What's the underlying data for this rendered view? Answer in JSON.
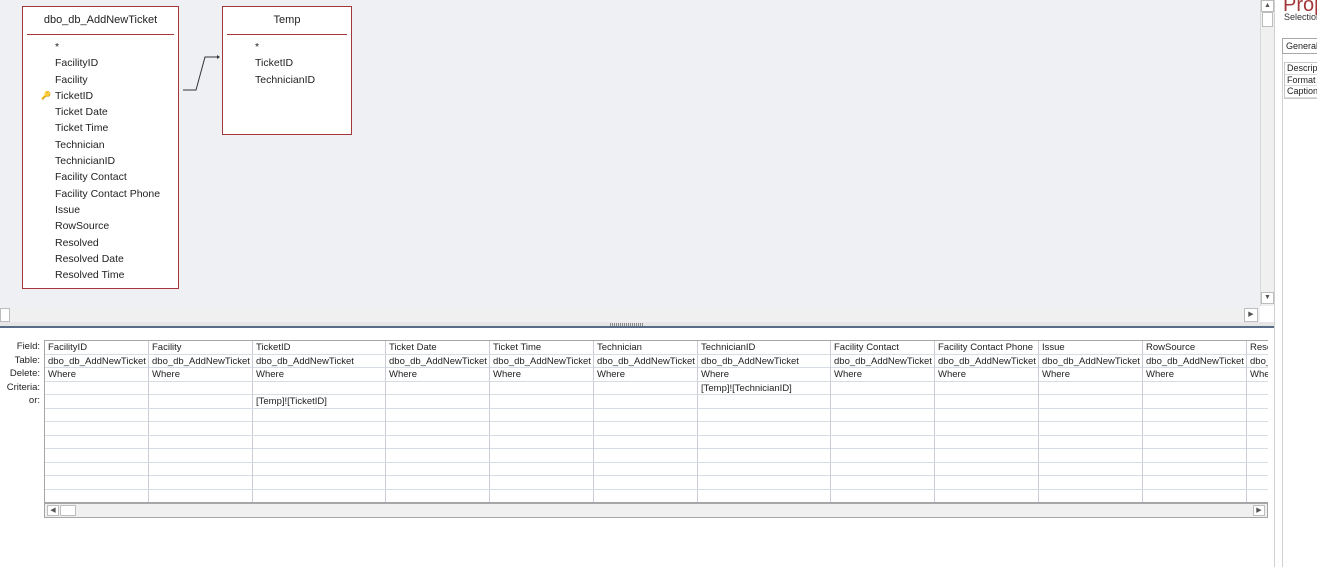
{
  "diagram": {
    "tables": [
      {
        "name": "dbo_db_AddNewTicket",
        "fields": [
          "*",
          "FacilityID",
          "Facility",
          "TicketID",
          "Ticket Date",
          "Ticket Time",
          "Technician",
          "TechnicianID",
          "Facility Contact",
          "Facility Contact Phone",
          "Issue",
          "RowSource",
          "Resolved",
          "Resolved Date",
          "Resolved Time"
        ],
        "primary_key": "TicketID"
      },
      {
        "name": "Temp",
        "fields": [
          "*",
          "TicketID",
          "TechnicianID"
        ]
      }
    ]
  },
  "qbe": {
    "row_labels": [
      "Field:",
      "Table:",
      "Delete:",
      "Criteria:",
      "or:"
    ],
    "columns": [
      {
        "field": "FacilityID",
        "table": "dbo_db_AddNewTicket",
        "delete": "Where",
        "criteria": "",
        "or": ""
      },
      {
        "field": "Facility",
        "table": "dbo_db_AddNewTicket",
        "delete": "Where",
        "criteria": "",
        "or": ""
      },
      {
        "field": "TicketID",
        "table": "dbo_db_AddNewTicket",
        "delete": "Where",
        "criteria": "",
        "or": "[Temp]![TicketID]"
      },
      {
        "field": "Ticket Date",
        "table": "dbo_db_AddNewTicket",
        "delete": "Where",
        "criteria": "",
        "or": ""
      },
      {
        "field": "Ticket Time",
        "table": "dbo_db_AddNewTicket",
        "delete": "Where",
        "criteria": "",
        "or": ""
      },
      {
        "field": "Technician",
        "table": "dbo_db_AddNewTicket",
        "delete": "Where",
        "criteria": "",
        "or": ""
      },
      {
        "field": "TechnicianID",
        "table": "dbo_db_AddNewTicket",
        "delete": "Where",
        "criteria": "[Temp]![TechnicianID]",
        "or": ""
      },
      {
        "field": "Facility Contact",
        "table": "dbo_db_AddNewTicket",
        "delete": "Where",
        "criteria": "",
        "or": ""
      },
      {
        "field": "Facility Contact Phone",
        "table": "dbo_db_AddNewTicket",
        "delete": "Where",
        "criteria": "",
        "or": ""
      },
      {
        "field": "Issue",
        "table": "dbo_db_AddNewTicket",
        "delete": "Where",
        "criteria": "",
        "or": ""
      },
      {
        "field": "RowSource",
        "table": "dbo_db_AddNewTicket",
        "delete": "Where",
        "criteria": "",
        "or": ""
      },
      {
        "field": "Resolved",
        "table": "dbo_db_AddNewTicket",
        "delete": "Where",
        "criteria": "",
        "or": ""
      }
    ]
  },
  "property_sheet": {
    "title": "Property Sheet",
    "selection_type": "Selection type:",
    "tab": "General",
    "properties": [
      "Description",
      "Format",
      "Caption"
    ]
  },
  "icons": {
    "scroll_up": "scroll-up-arrow-icon",
    "scroll_down": "scroll-down-arrow-icon",
    "scroll_left": "scroll-left-arrow-icon",
    "scroll_right": "scroll-right-arrow-icon",
    "key": "primary-key-icon"
  },
  "colors": {
    "table_border": "#a4373a",
    "pane_background": "#eef0f3",
    "splitter_line": "#5a6b86"
  }
}
